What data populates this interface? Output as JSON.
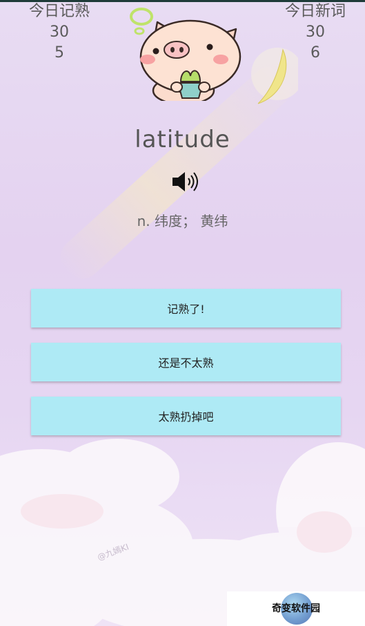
{
  "stats": {
    "left": {
      "title": "今日记熟",
      "line1": "30",
      "line2": "5"
    },
    "right": {
      "title": "今日新词",
      "line1": "30",
      "line2": "6"
    }
  },
  "word": {
    "text": "latitude",
    "meaning": "n. 纬度； 黄纬",
    "speaker_icon": "speaker-icon"
  },
  "buttons": {
    "known": "记熟了!",
    "not_familiar": "还是不太熟",
    "too_familiar": "太熟扔掉吧"
  },
  "watermark": {
    "text": "奇变软件园",
    "artist": "@九嫣KI"
  },
  "colors": {
    "button_bg": "#aeeaf5",
    "text_dark": "#555555",
    "background": "#e6d6f2"
  }
}
